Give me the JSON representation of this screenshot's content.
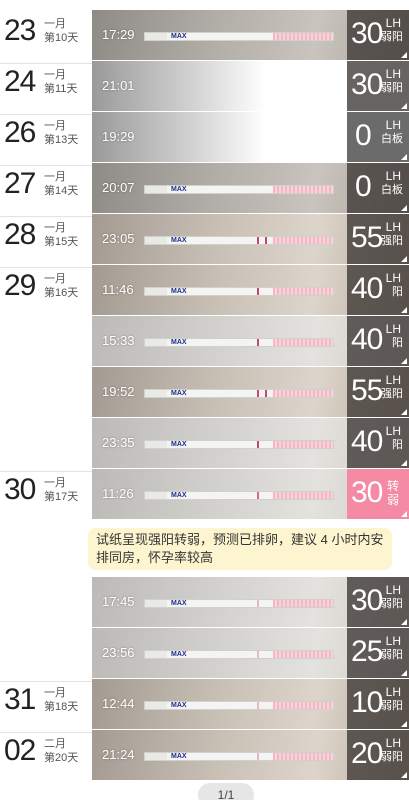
{
  "entries": [
    {
      "day": "23",
      "month": "一月",
      "cycle": "第10天",
      "time": "17:29",
      "value": "30",
      "unit": "LH",
      "level": "弱阳",
      "style": "dark",
      "tline": "faint"
    },
    {
      "day": "24",
      "month": "一月",
      "cycle": "第11天",
      "time": "21:01",
      "value": "30",
      "unit": "LH",
      "level": "弱阳",
      "style": "fade",
      "tline": "none"
    },
    {
      "day": "26",
      "month": "一月",
      "cycle": "第13天",
      "time": "19:29",
      "value": "0",
      "unit": "LH",
      "level": "白板",
      "style": "fade",
      "tline": "none"
    },
    {
      "day": "27",
      "month": "一月",
      "cycle": "第14天",
      "time": "20:07",
      "value": "0",
      "unit": "LH",
      "level": "白板",
      "style": "dark",
      "tline": "none"
    },
    {
      "day": "28",
      "month": "一月",
      "cycle": "第15天",
      "time": "23:05",
      "value": "55",
      "unit": "LH",
      "level": "强阳",
      "style": "warm",
      "tline": "strong"
    },
    {
      "day": "29",
      "month": "一月",
      "cycle": "第16天",
      "time": "11:46",
      "value": "40",
      "unit": "LH",
      "level": "阳",
      "style": "warm",
      "tline": "strong"
    },
    {
      "day": "",
      "month": "",
      "cycle": "",
      "time": "15:33",
      "value": "40",
      "unit": "LH",
      "level": "阳",
      "style": "light",
      "tline": "strong"
    },
    {
      "day": "",
      "month": "",
      "cycle": "",
      "time": "19:52",
      "value": "55",
      "unit": "LH",
      "level": "强阳",
      "style": "warm",
      "tline": "strong"
    },
    {
      "day": "",
      "month": "",
      "cycle": "",
      "time": "23:35",
      "value": "40",
      "unit": "LH",
      "level": "阳",
      "style": "light",
      "tline": "strong"
    },
    {
      "day": "30",
      "month": "一月",
      "cycle": "第17天",
      "time": "11:26",
      "value": "30",
      "unit": "",
      "level": "转弱",
      "style": "light",
      "tline": "faint",
      "highlight": true
    },
    {
      "day": "",
      "month": "",
      "cycle": "",
      "time": "17:45",
      "value": "30",
      "unit": "LH",
      "level": "弱阳",
      "style": "light",
      "tline": "faint"
    },
    {
      "day": "",
      "month": "",
      "cycle": "",
      "time": "23:56",
      "value": "25",
      "unit": "LH",
      "level": "弱阳",
      "style": "light",
      "tline": "faint"
    },
    {
      "day": "31",
      "month": "一月",
      "cycle": "第18天",
      "time": "12:44",
      "value": "10",
      "unit": "LH",
      "level": "弱阳",
      "style": "warm",
      "tline": "faint"
    },
    {
      "day": "02",
      "month": "二月",
      "cycle": "第20天",
      "time": "21:24",
      "value": "20",
      "unit": "LH",
      "level": "弱阳",
      "style": "warm",
      "tline": "faint"
    }
  ],
  "note": "试纸呈现强阳转弱，预测已排卵，建议 4 小时内安排同房，怀孕率较高",
  "strip_label": "MAX",
  "pager": "1/1",
  "colors": {
    "accent_pink": "#f48aa3",
    "note_bg": "#fdf5cf",
    "value_box": "#3c3734"
  }
}
